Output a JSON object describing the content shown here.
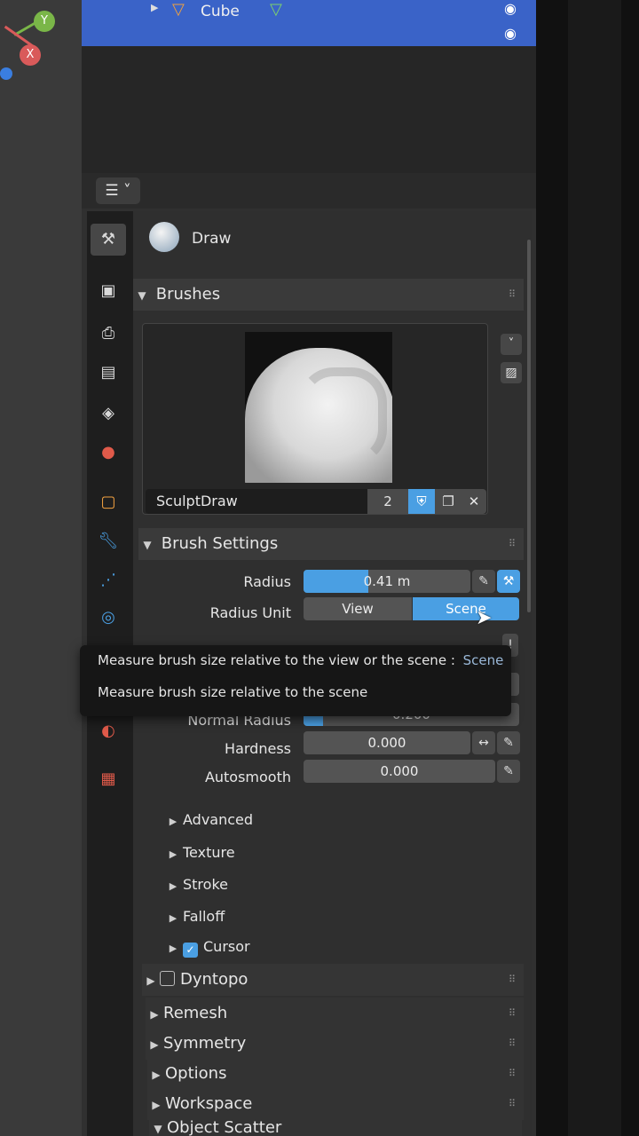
{
  "gizmo": {
    "y_label": "Y",
    "x_label": "X"
  },
  "outliner": {
    "object_name": "Cube"
  },
  "editor_type_icon": "properties-editor-icon",
  "tool": {
    "name": "Draw"
  },
  "brushes_panel": {
    "title": "Brushes",
    "brush_name": "SculptDraw",
    "users": "2"
  },
  "brush_settings": {
    "title": "Brush Settings",
    "radius_label": "Radius",
    "radius_value": "0.41 m",
    "radius_fill_fraction": 0.39,
    "radius_unit_label": "Radius Unit",
    "radius_unit_options": [
      "View",
      "Scene"
    ],
    "radius_unit_selected": "Scene",
    "normal_radius_label": "Normal Radius",
    "normal_radius_value": "0.200",
    "normal_radius_fill_fraction": 0.09,
    "hardness_label": "Hardness",
    "hardness_value": "0.000",
    "autosmooth_label": "Autosmooth",
    "autosmooth_value": "0.000"
  },
  "tooltip": {
    "line1": "Measure brush size relative to the view or the scene :",
    "line1_value": "Scene",
    "line2": "Measure brush size relative to the scene"
  },
  "subpanels": [
    "Advanced",
    "Texture",
    "Stroke",
    "Falloff"
  ],
  "cursor_label": "Cursor",
  "panels": [
    "Remesh",
    "Symmetry",
    "Options",
    "Workspace"
  ],
  "dyntopo_label": "Dyntopo",
  "object_scatter_label": "Object Scatter",
  "colors": {
    "accent": "#4a9fe3",
    "selection_row": "#3a63c8"
  }
}
